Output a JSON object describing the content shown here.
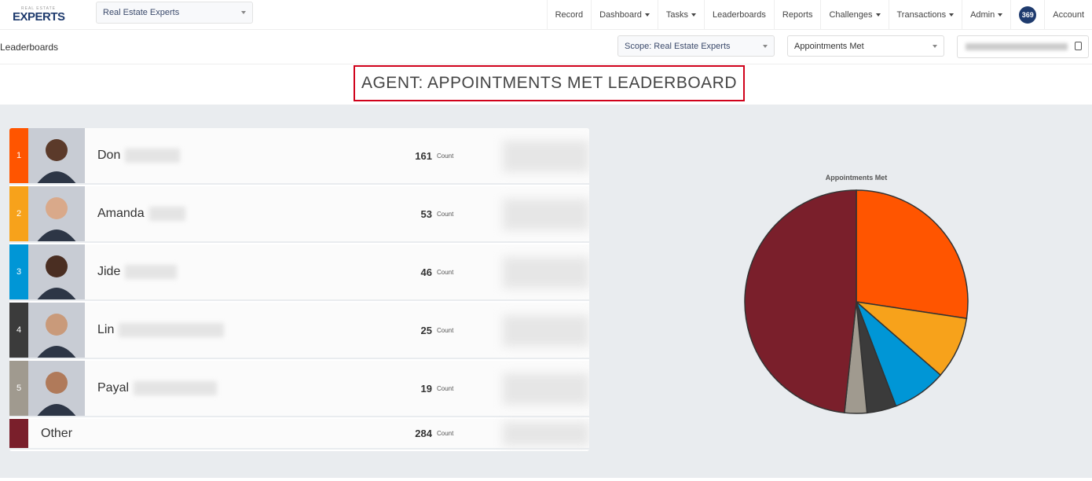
{
  "header": {
    "logo_small": "REAL ESTATE",
    "logo_big": "EXPERTS",
    "org": "Real Estate Experts",
    "nav": [
      {
        "label": "Record",
        "dd": false
      },
      {
        "label": "Dashboard",
        "dd": true
      },
      {
        "label": "Tasks",
        "dd": true
      },
      {
        "label": "Leaderboards",
        "dd": false
      },
      {
        "label": "Reports",
        "dd": false
      },
      {
        "label": "Challenges",
        "dd": true
      },
      {
        "label": "Transactions",
        "dd": true
      },
      {
        "label": "Admin",
        "dd": true
      }
    ],
    "badge": "369",
    "account": "Account"
  },
  "subbar": {
    "breadcrumb": "Leaderboards",
    "scope": "Scope: Real Estate Experts",
    "metric": "Appointments Met",
    "date_icon": "calendar-icon"
  },
  "title": "AGENT: APPOINTMENTS MET LEADERBOARD",
  "count_label": "Count",
  "rows": [
    {
      "rank": "1",
      "name": "Don",
      "count": "161",
      "color": "#ff5500"
    },
    {
      "rank": "2",
      "name": "Amanda",
      "count": "53",
      "color": "#f7a21b"
    },
    {
      "rank": "3",
      "name": "Jide",
      "count": "46",
      "color": "#0096d6"
    },
    {
      "rank": "4",
      "name": "Lin",
      "count": "25",
      "color": "#3b3b3b"
    },
    {
      "rank": "5",
      "name": "Payal",
      "count": "19",
      "color": "#a09a8f"
    },
    {
      "rank": "",
      "name": "Other",
      "count": "284",
      "color": "#7a1f2b"
    }
  ],
  "chart_data": {
    "type": "pie",
    "title": "Appointments Met",
    "categories": [
      "Don",
      "Amanda",
      "Jide",
      "Lin",
      "Payal",
      "Other"
    ],
    "values": [
      161,
      53,
      46,
      25,
      19,
      284
    ],
    "colors": [
      "#ff5500",
      "#f7a21b",
      "#0096d6",
      "#3b3b3b",
      "#a09a8f",
      "#7a1f2b"
    ]
  }
}
